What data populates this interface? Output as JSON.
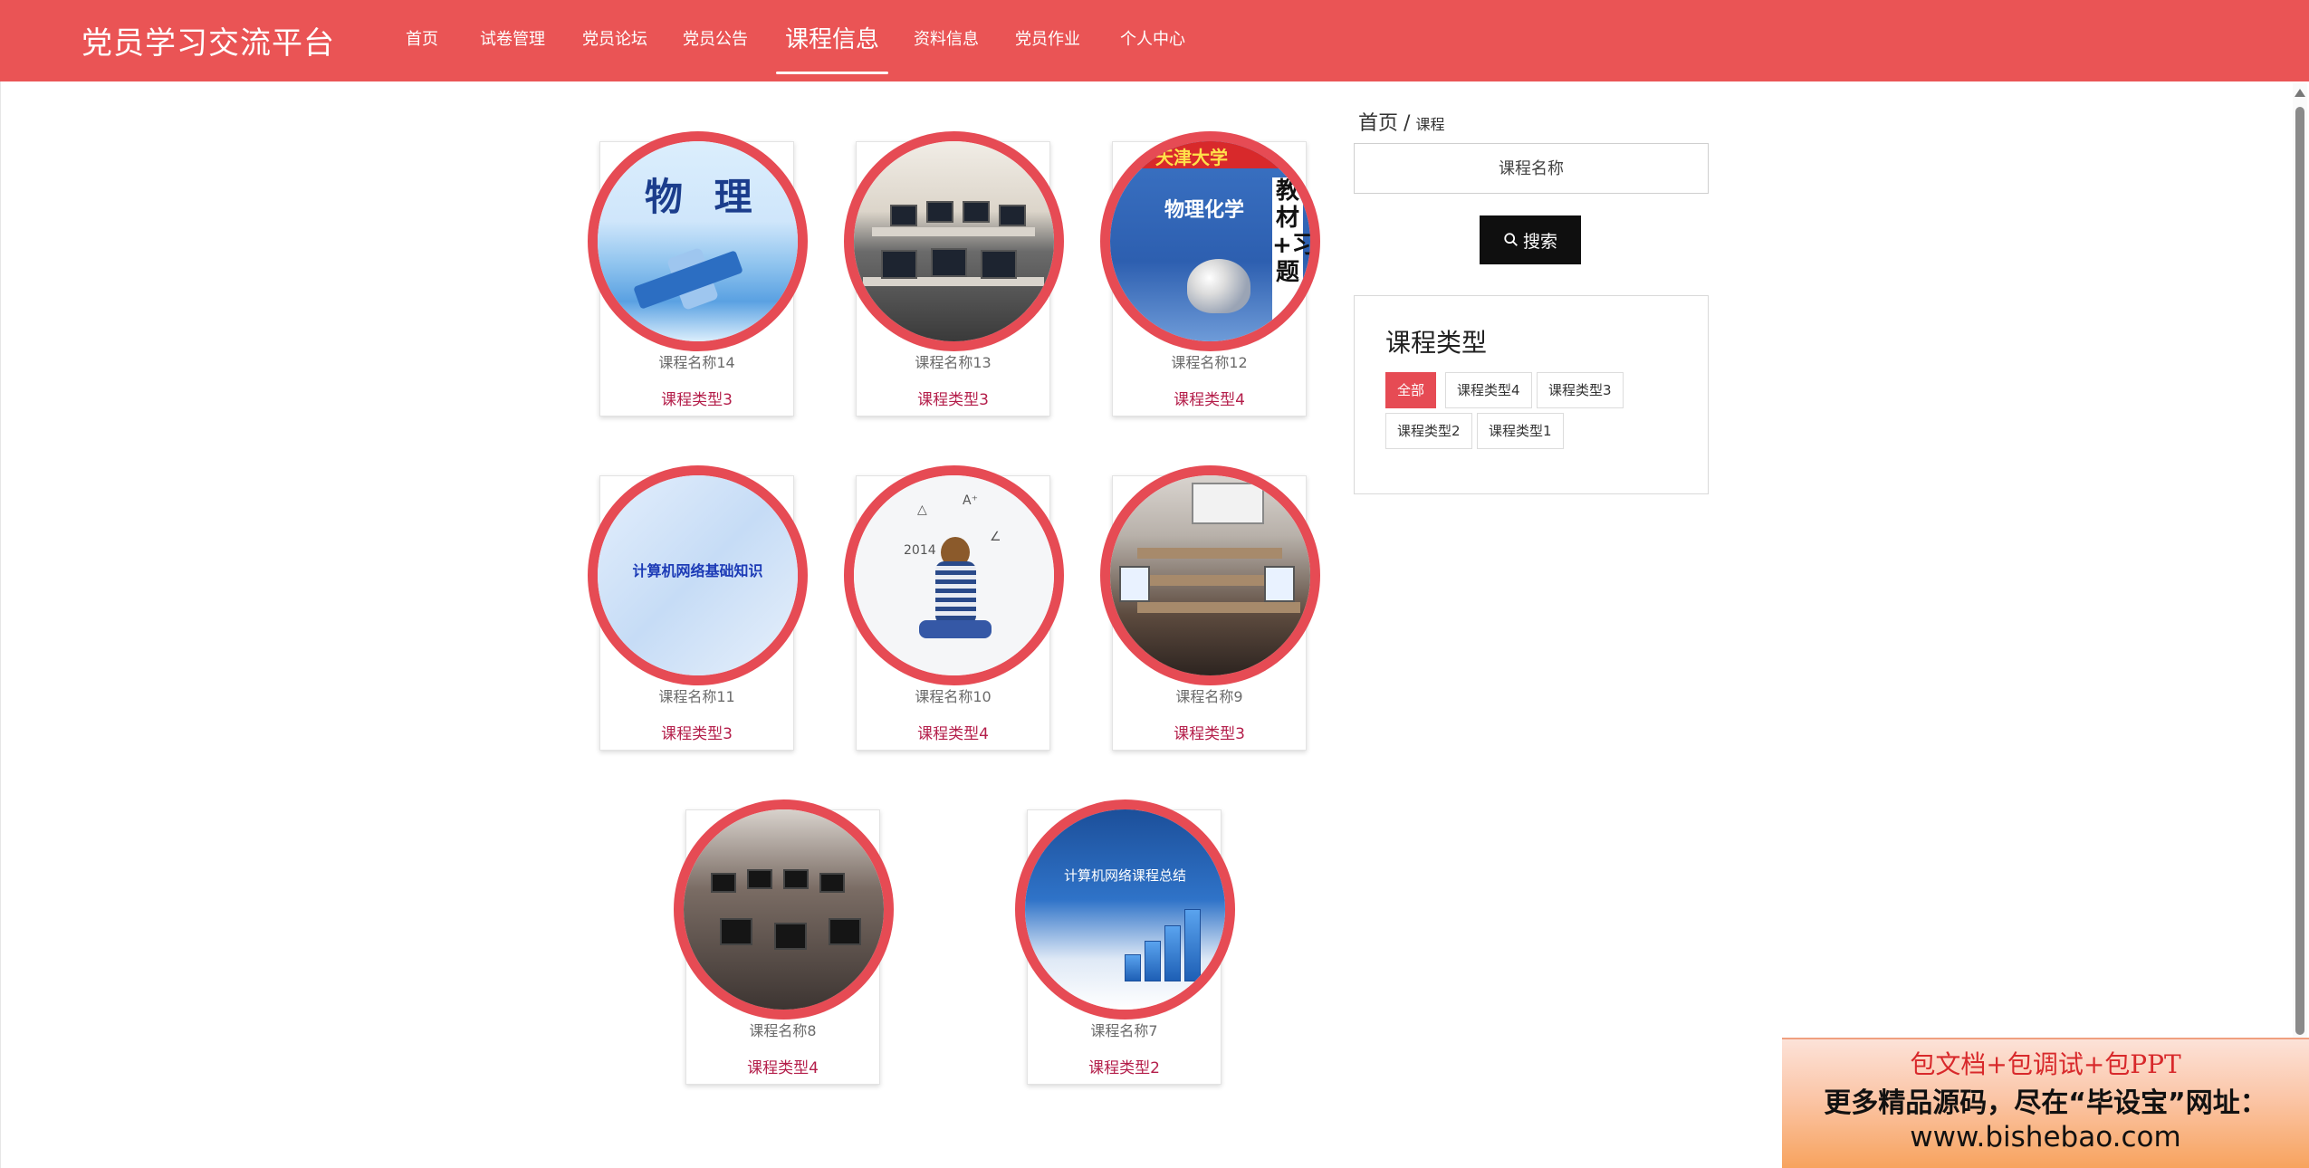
{
  "app": {
    "title": "党员学习交流平台"
  },
  "nav": {
    "items": [
      {
        "label": "首页"
      },
      {
        "label": "试卷管理"
      },
      {
        "label": "党员论坛"
      },
      {
        "label": "党员公告"
      },
      {
        "label": "课程信息",
        "active": true
      },
      {
        "label": "资料信息"
      },
      {
        "label": "党员作业"
      },
      {
        "label": "个人中心"
      }
    ]
  },
  "courses": [
    {
      "name": "课程名称14",
      "type": "课程类型3",
      "image": "physics-textbook"
    },
    {
      "name": "课程名称13",
      "type": "课程类型3",
      "image": "computer-lab"
    },
    {
      "name": "课程名称12",
      "type": "课程类型4",
      "image": "tianjin-university-books"
    },
    {
      "name": "课程名称11",
      "type": "课程类型3",
      "image": "network-basics-cover"
    },
    {
      "name": "课程名称10",
      "type": "课程类型4",
      "image": "girl-reading-sketch"
    },
    {
      "name": "课程名称9",
      "type": "课程类型3",
      "image": "classroom-lecture"
    },
    {
      "name": "课程名称8",
      "type": "课程类型4",
      "image": "students-computer-room"
    },
    {
      "name": "课程名称7",
      "type": "课程类型2",
      "image": "network-course-summary"
    }
  ],
  "images": {
    "physics_title": "物 理",
    "books_banner": "天津大学",
    "books_title": "物理化学",
    "books_side": "教材+习题",
    "network_cover_text": "计算机网络基础知识",
    "summary_cover_text": "计算机网络课程总结"
  },
  "breadcrumb": {
    "home": "首页",
    "separator": "/",
    "current": "课程"
  },
  "search": {
    "placeholder": "课程名称",
    "value": "",
    "button_label": "搜索"
  },
  "types": {
    "title": "课程类型",
    "items": [
      {
        "label": "全部",
        "active": true
      },
      {
        "label": "课程类型4"
      },
      {
        "label": "课程类型3"
      },
      {
        "label": "课程类型2"
      },
      {
        "label": "课程类型1"
      }
    ]
  },
  "ad": {
    "line1": "包文档+包调试+包PPT",
    "line2": "更多精品源码，尽在“毕设宝”网址：",
    "line3": "www.bishebao.com"
  },
  "colors": {
    "primary": "#ea5455",
    "ring": "#e64b54",
    "type_text": "#b41e4a",
    "button": "#0f0f0f"
  }
}
